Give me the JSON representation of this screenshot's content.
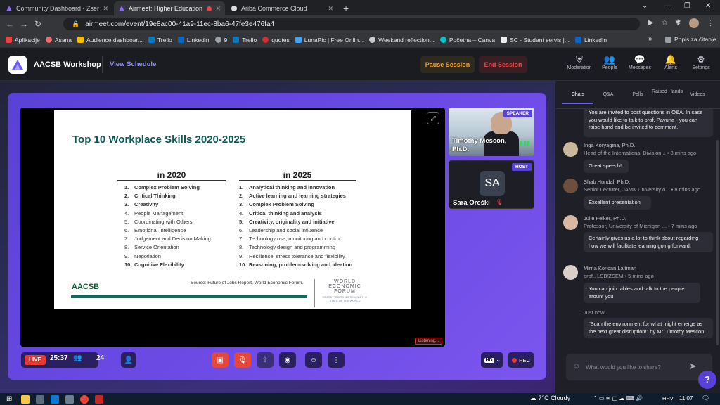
{
  "browser": {
    "tabs": [
      {
        "title": "Community Dashboard - Zsema",
        "close": "✕"
      },
      {
        "title": "Airmeet: Higher Education Ir",
        "close": "✕"
      },
      {
        "title": "Ariba Commerce Cloud",
        "close": "✕"
      }
    ],
    "new_tab": "+",
    "url": "airmeet.com/event/19e8ac00-41a9-11ec-8ba6-47fe3e476fa4",
    "bookmarks": [
      {
        "label": "Aplikacije",
        "color": "#e8453c"
      },
      {
        "label": "Asana",
        "color": "#f06a6a"
      },
      {
        "label": "Audience dashboar...",
        "color": "#fbbc05"
      },
      {
        "label": "Trello",
        "color": "#0079bf"
      },
      {
        "label": "Linkedin",
        "color": "#0a66c2"
      },
      {
        "label": "9",
        "color": "#9aa0a6"
      },
      {
        "label": "Trello",
        "color": "#0079bf"
      },
      {
        "label": "quotes",
        "color": "#d32f2f"
      },
      {
        "label": "LunaPic | Free Onlin...",
        "color": "#42a5f5"
      },
      {
        "label": "Weekend reflection...",
        "color": "#cccccc"
      },
      {
        "label": "Početna – Canva",
        "color": "#00c4cc"
      },
      {
        "label": "SC - Student servis |...",
        "color": "#333333"
      },
      {
        "label": "LinkedIn",
        "color": "#0a66c2"
      }
    ],
    "bookmarks_more": "»",
    "reading_list": "Popis za čitanje"
  },
  "header": {
    "event_name": "AACSB Workshop",
    "view_schedule": "View Schedule",
    "pause_session": "Pause Session",
    "end_session": "End Session",
    "icons": [
      "Moderation",
      "People",
      "Messages",
      "Alerts",
      "Settings"
    ]
  },
  "slide": {
    "title": "Top 10 Workplace Skills 2020-2025",
    "col2020": {
      "heading": "in 2020",
      "items": [
        {
          "n": "1.",
          "text": "Complex Problem Solving",
          "bold": true
        },
        {
          "n": "2.",
          "text": "Critical Thinking",
          "bold": true
        },
        {
          "n": "3.",
          "text": "Creativity",
          "bold": true
        },
        {
          "n": "4.",
          "text": "People Management",
          "bold": false
        },
        {
          "n": "5.",
          "text": "Coordinating with Others",
          "bold": false
        },
        {
          "n": "6.",
          "text": "Emotional Intelligence",
          "bold": false
        },
        {
          "n": "7.",
          "text": "Judgement and Decision Making",
          "bold": false
        },
        {
          "n": "8.",
          "text": "Service Orientation",
          "bold": false
        },
        {
          "n": "9.",
          "text": "Negotiation",
          "bold": false
        },
        {
          "n": "10.",
          "text": "Cognitive Flexibility",
          "bold": true
        }
      ]
    },
    "col2025": {
      "heading": "in 2025",
      "items": [
        {
          "n": "1.",
          "text": "Analytical thinking and innovation",
          "bold": true
        },
        {
          "n": "2.",
          "text": "Active learning and learning strategies",
          "bold": true
        },
        {
          "n": "3.",
          "text": "Complex Problem Solving",
          "bold": true
        },
        {
          "n": "4.",
          "text": "Critical thinking and analysis",
          "bold": true
        },
        {
          "n": "5.",
          "text": "Creativity, originality and initiative",
          "bold": true
        },
        {
          "n": "6.",
          "text": "Leadership and social influence",
          "bold": false
        },
        {
          "n": "7.",
          "text": "Technology use, monitoring and control",
          "bold": false
        },
        {
          "n": "8.",
          "text": "Technology design and programming",
          "bold": false
        },
        {
          "n": "9.",
          "text": "Resilience, stress tolerance and flexibility",
          "bold": false
        },
        {
          "n": "10.",
          "text": "Reasoning, problem-solving and ideation",
          "bold": true
        }
      ]
    },
    "logo": "AACSB",
    "source": "Source: Future of Jobs Report, World Economic Forum.",
    "wef": "WORLD ECONOMIC FORUM",
    "wef_tagline": "COMMITTED TO IMPROVING THE STATE OF THE WORLD"
  },
  "stage": {
    "listening": "Listening...",
    "speaker_badge": "SPEAKER",
    "speaker_name": "Timothy Mescon, Ph.D.",
    "host_badge": "HOST",
    "host_initials": "SA",
    "host_name": "Sara Oreški"
  },
  "controls": {
    "live": "LIVE",
    "timer": "25:37",
    "attendees": "24",
    "quality": "HD",
    "record": "REC"
  },
  "panel": {
    "tabs": [
      "Chats",
      "Q&A",
      "Polls",
      "Raised Hands",
      "Videos"
    ],
    "messages": [
      {
        "name": "",
        "role": "",
        "time": "",
        "text": "You are invited to post questions in Q&A. In case you would like to talk to prof. Pavuna - you can raise hand and be invited to comment."
      },
      {
        "name": "Inga Koryagina, Ph.D.",
        "role": "Head of the International Division...",
        "time": "• 8 mins ago",
        "text": "Great speech!"
      },
      {
        "name": "Shab Hundal, Ph.D.",
        "role": "Senior Lecturer, JAMK University o...",
        "time": "• 8 mins ago",
        "text": "Excellent presentation"
      },
      {
        "name": "Julie Felker, Ph.D.",
        "role": "Professor, University of Michigan-...",
        "time": "• 7 mins ago",
        "text": "Certainly gives us a lot to think about regarding how we will facilitate learning going forward."
      },
      {
        "name": "Mirna Korican Lajtman",
        "role": "prof., LSB/ZSEM",
        "time": "• 5 mins ago",
        "text": "You can join tables and talk to the people arounf you"
      },
      {
        "name": "",
        "role": "",
        "time": "Just now",
        "text": "\"Scan the environment for what might emerge as the next great disruption!\" by Mr. Timothy Mescon"
      }
    ],
    "input_placeholder": "What would you like to share?",
    "help": "?"
  },
  "taskbar": {
    "weather": "7°C  Cloudy",
    "lang": "HRV",
    "time": "11:07"
  }
}
